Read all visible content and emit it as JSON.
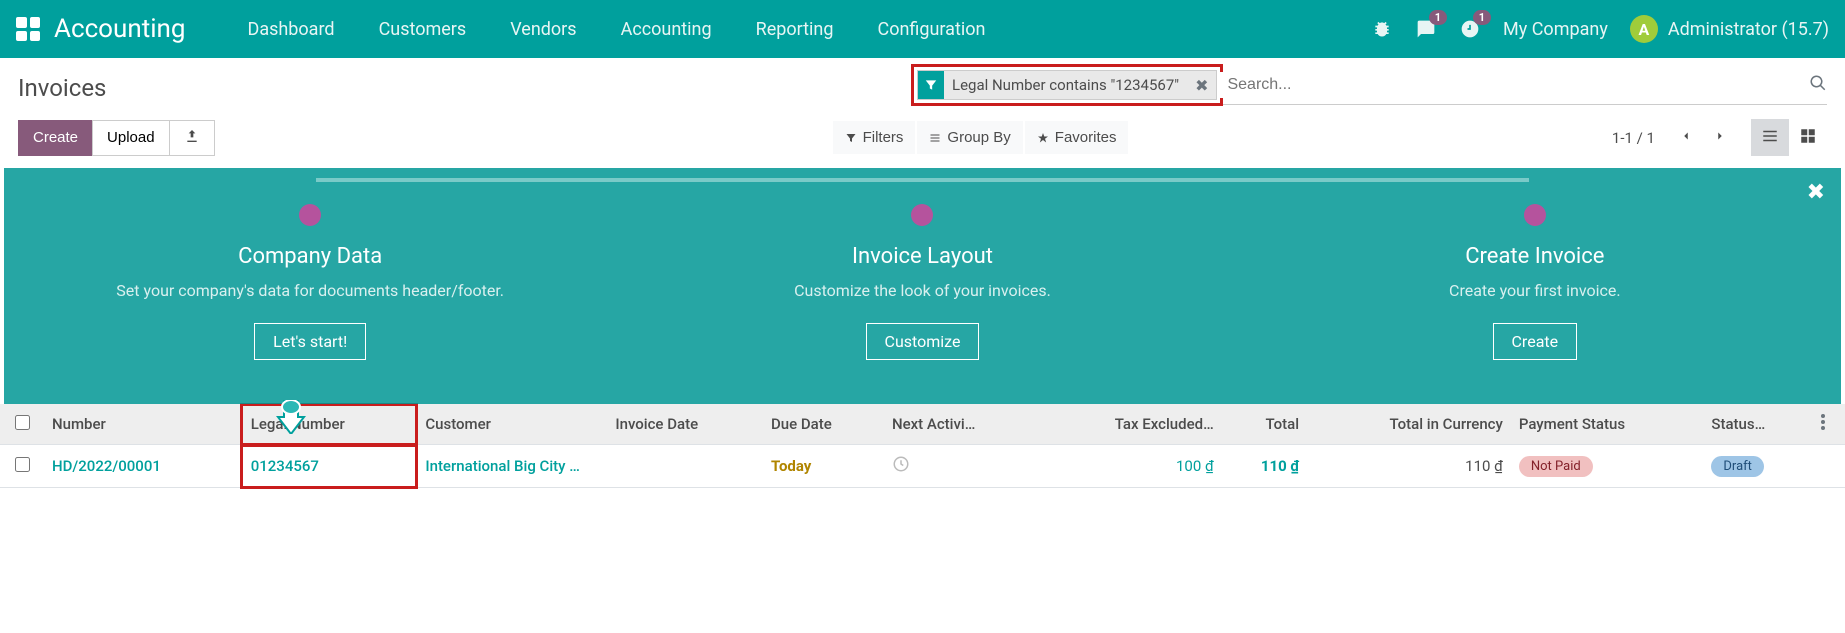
{
  "navbar": {
    "title": "Accounting",
    "menu": [
      "Dashboard",
      "Customers",
      "Vendors",
      "Accounting",
      "Reporting",
      "Configuration"
    ],
    "msg_badge": "1",
    "activity_badge": "1",
    "company": "My Company",
    "user_initial": "A",
    "user_label": "Administrator (15.7)"
  },
  "breadcrumb": "Invoices",
  "search": {
    "facet_label": "Legal Number contains \"1234567\"",
    "placeholder": "Search..."
  },
  "buttons": {
    "create": "Create",
    "upload": "Upload",
    "filters": "Filters",
    "groupby": "Group By",
    "favorites": "Favorites"
  },
  "pager": "1-1 / 1",
  "onboarding": {
    "steps": [
      {
        "title": "Company Data",
        "desc": "Set your company's data for documents header/footer.",
        "btn": "Let's start!"
      },
      {
        "title": "Invoice Layout",
        "desc": "Customize the look of your invoices.",
        "btn": "Customize"
      },
      {
        "title": "Create Invoice",
        "desc": "Create your first invoice.",
        "btn": "Create"
      }
    ]
  },
  "table": {
    "headers": {
      "number": "Number",
      "legal": "Legal Number",
      "customer": "Customer",
      "invoice_date": "Invoice Date",
      "due_date": "Due Date",
      "activity": "Next Activi…",
      "tax_excl": "Tax Excluded…",
      "total": "Total",
      "total_curr": "Total in Currency",
      "pay_status": "Payment Status",
      "status": "Status…"
    },
    "rows": [
      {
        "number": "HD/2022/00001",
        "legal": "01234567",
        "customer": "International Big City …",
        "invoice_date": "",
        "due_date": "Today",
        "tax_excl": "100 ₫",
        "total": "110 ₫",
        "total_curr": "110 ₫",
        "pay_status": "Not Paid",
        "status": "Draft"
      }
    ]
  }
}
